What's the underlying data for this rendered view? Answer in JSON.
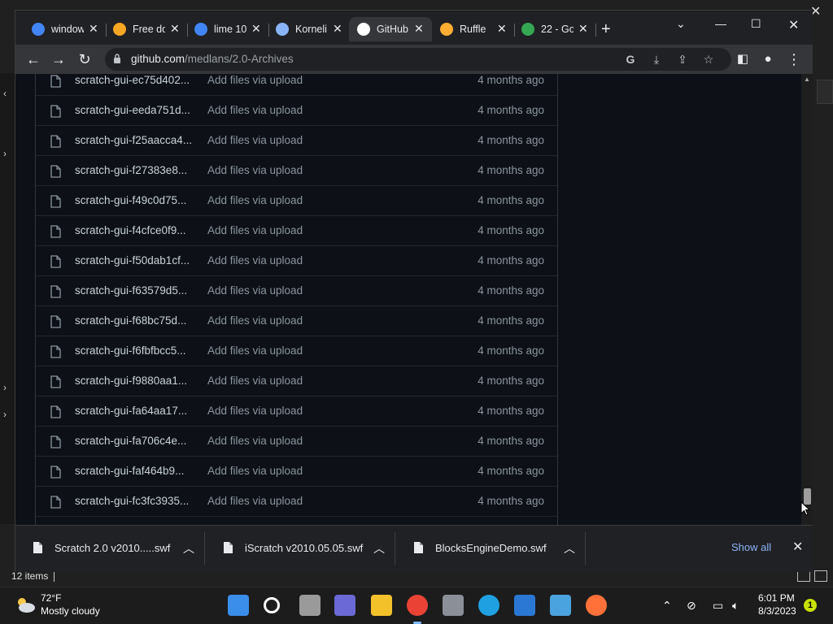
{
  "background_window": {
    "status_text": "12 items"
  },
  "tabs": [
    {
      "title": "window",
      "favicon": "google-icon",
      "color": "#4285f4"
    },
    {
      "title": "Free do",
      "favicon": "w-logo-icon",
      "color": "#f5a623"
    },
    {
      "title": "lime 10",
      "favicon": "google-icon",
      "color": "#4285f4"
    },
    {
      "title": "Korneli",
      "favicon": "shield-logo-icon",
      "color": "#8ab4f8"
    },
    {
      "title": "GitHub",
      "favicon": "github-icon",
      "color": "#ffffff",
      "active": true
    },
    {
      "title": "Ruffle",
      "favicon": "ruffle-icon",
      "color": "#ffad33"
    },
    {
      "title": "22 - Go",
      "favicon": "drive-icon",
      "color": "#34a853"
    }
  ],
  "toolbar": {
    "url_host": "github.com",
    "url_path": "/medlans/2.0-Archives"
  },
  "files": [
    {
      "name": "scratch-gui-ec75d402...",
      "message": "Add files via upload",
      "age": "4 months ago"
    },
    {
      "name": "scratch-gui-eeda751d...",
      "message": "Add files via upload",
      "age": "4 months ago"
    },
    {
      "name": "scratch-gui-f25aacca4...",
      "message": "Add files via upload",
      "age": "4 months ago"
    },
    {
      "name": "scratch-gui-f27383e8...",
      "message": "Add files via upload",
      "age": "4 months ago"
    },
    {
      "name": "scratch-gui-f49c0d75...",
      "message": "Add files via upload",
      "age": "4 months ago"
    },
    {
      "name": "scratch-gui-f4cfce0f9...",
      "message": "Add files via upload",
      "age": "4 months ago"
    },
    {
      "name": "scratch-gui-f50dab1cf...",
      "message": "Add files via upload",
      "age": "4 months ago"
    },
    {
      "name": "scratch-gui-f63579d5...",
      "message": "Add files via upload",
      "age": "4 months ago"
    },
    {
      "name": "scratch-gui-f68bc75d...",
      "message": "Add files via upload",
      "age": "4 months ago"
    },
    {
      "name": "scratch-gui-f6fbfbcc5...",
      "message": "Add files via upload",
      "age": "4 months ago"
    },
    {
      "name": "scratch-gui-f9880aa1...",
      "message": "Add files via upload",
      "age": "4 months ago"
    },
    {
      "name": "scratch-gui-fa64aa17...",
      "message": "Add files via upload",
      "age": "4 months ago"
    },
    {
      "name": "scratch-gui-fa706c4e...",
      "message": "Add files via upload",
      "age": "4 months ago"
    },
    {
      "name": "scratch-gui-faf464b9...",
      "message": "Add files via upload",
      "age": "4 months ago"
    },
    {
      "name": "scratch-gui-fc3fc3935...",
      "message": "Add files via upload",
      "age": "4 months ago"
    }
  ],
  "downloads": [
    {
      "name": "Scratch 2.0 v2010.....swf"
    },
    {
      "name": "iScratch v2010.05.05.swf"
    },
    {
      "name": "BlocksEngineDemo.swf"
    }
  ],
  "downloads_bar": {
    "show_all_label": "Show all"
  },
  "taskbar": {
    "temperature": "72°F",
    "condition": "Mostly cloudy",
    "time": "6:01 PM",
    "date": "8/3/2023",
    "notification_count": "1",
    "apps": [
      "windows-start-icon",
      "search-icon",
      "task-view-icon",
      "chat-icon",
      "file-explorer-icon",
      "chrome-icon",
      "settings-icon",
      "edge-icon",
      "store-icon",
      "mail-icon",
      "firefox-icon"
    ]
  },
  "colors": {
    "page_bg": "#0d1117",
    "link_blue": "#8ab4f8",
    "text_primary": "#c9d1d9",
    "text_muted": "#8b949e"
  }
}
